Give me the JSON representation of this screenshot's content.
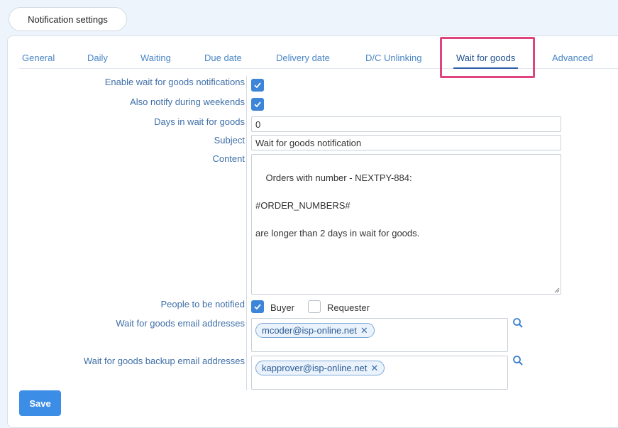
{
  "header": {
    "title": "Notification settings"
  },
  "tabs": [
    {
      "label": "General"
    },
    {
      "label": "Daily"
    },
    {
      "label": "Waiting"
    },
    {
      "label": "Due date"
    },
    {
      "label": "Delivery date"
    },
    {
      "label": "D/C Unlinking"
    },
    {
      "label": "Wait for goods"
    },
    {
      "label": "Advanced"
    }
  ],
  "active_tab": "Wait for goods",
  "form": {
    "enable_label": "Enable wait for goods notifications",
    "enable_checked": true,
    "weekends_label": "Also notify during weekends",
    "weekends_checked": true,
    "days_label": "Days in wait for goods",
    "days_value": "0",
    "subject_label": "Subject",
    "subject_value": "Wait for goods notification",
    "content_label": "Content",
    "content_value": "Orders with number - NEXTPY-884:\n\n#ORDER_NUMBERS#\n\nare longer than 2 days in wait for goods.",
    "people_label": "People to be notified",
    "buyer_label": "Buyer",
    "buyer_checked": true,
    "requester_label": "Requester",
    "requester_checked": false,
    "emails_label": "Wait for goods email addresses",
    "emails": [
      "mcoder@isp-online.net"
    ],
    "backup_label": "Wait for goods backup email addresses",
    "backup_emails": [
      "kapprover@isp-online.net"
    ]
  },
  "actions": {
    "save_label": "Save"
  },
  "icons": {
    "checkbox_checked": "check-icon",
    "search": "search-icon",
    "remove": "close-icon"
  },
  "colors": {
    "accent": "#3b8de6",
    "label": "#3f6fa8",
    "highlight": "#e0447f"
  }
}
